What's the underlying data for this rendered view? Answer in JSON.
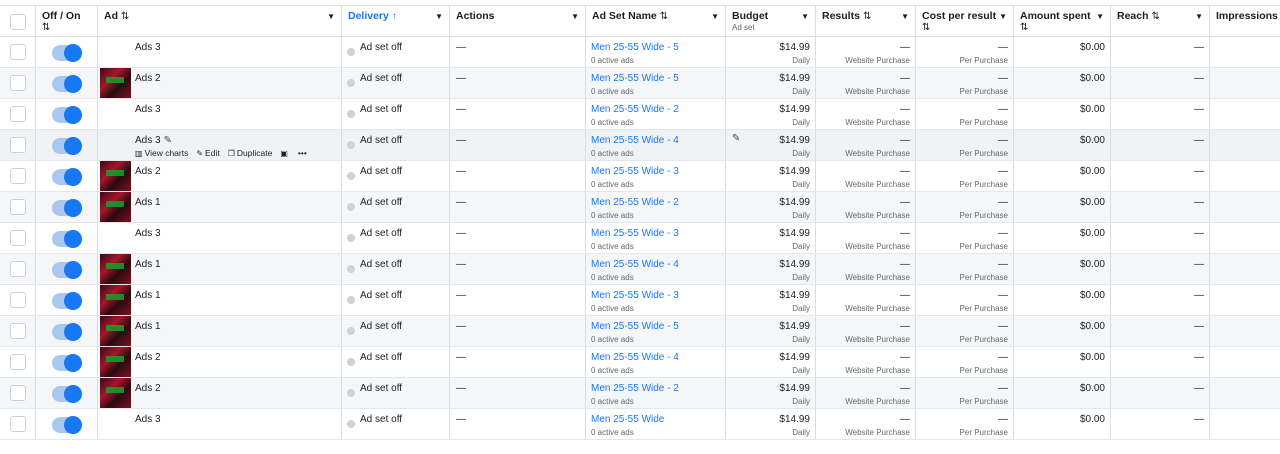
{
  "columns": {
    "toggle": "Off / On",
    "ad": "Ad",
    "delivery": "Delivery",
    "actions": "Actions",
    "adset": "Ad Set Name",
    "budget": "Budget",
    "budget_sub": "Ad set",
    "results": "Results",
    "cpr": "Cost per result",
    "amount": "Amount spent",
    "reach": "Reach",
    "impressions": "Impressions"
  },
  "icons": {
    "sort": "⇅",
    "sort_up": "↑",
    "caret": "▼",
    "pencil": "✎"
  },
  "hover_actions": {
    "view_charts": "View charts",
    "edit": "Edit",
    "duplicate": "Duplicate",
    "more": "•••"
  },
  "rows": [
    {
      "ad": "Ads 3",
      "thumb": false,
      "delivery": "Ad set off",
      "action": "—",
      "adset": "Men 25-55 Wide - 5",
      "adset_sub": "0 active ads",
      "budget": "$14.99",
      "budget_sub": "Daily",
      "results": "—",
      "results_sub": "Website Purchase",
      "cpr": "—",
      "cpr_sub": "Per Purchase",
      "amount": "$0.00",
      "reach": "—"
    },
    {
      "ad": "Ads 2",
      "thumb": true,
      "delivery": "Ad set off",
      "action": "—",
      "adset": "Men 25-55 Wide - 5",
      "adset_sub": "0 active ads",
      "budget": "$14.99",
      "budget_sub": "Daily",
      "results": "—",
      "results_sub": "Website Purchase",
      "cpr": "—",
      "cpr_sub": "Per Purchase",
      "amount": "$0.00",
      "reach": "—"
    },
    {
      "ad": "Ads 3",
      "thumb": false,
      "delivery": "Ad set off",
      "action": "—",
      "adset": "Men 25-55 Wide - 2",
      "adset_sub": "0 active ads",
      "budget": "$14.99",
      "budget_sub": "Daily",
      "results": "—",
      "results_sub": "Website Purchase",
      "cpr": "—",
      "cpr_sub": "Per Purchase",
      "amount": "$0.00",
      "reach": "—"
    },
    {
      "ad": "Ads 3",
      "thumb": false,
      "delivery": "Ad set off",
      "action": "—",
      "adset": "Men 25-55 Wide - 4",
      "adset_sub": "0 active ads",
      "budget": "$14.99",
      "budget_sub": "Daily",
      "results": "—",
      "results_sub": "Website Purchase",
      "cpr": "—",
      "cpr_sub": "Per Purchase",
      "amount": "$0.00",
      "reach": "—"
    },
    {
      "ad": "Ads 2",
      "thumb": true,
      "delivery": "Ad set off",
      "action": "—",
      "adset": "Men 25-55 Wide - 3",
      "adset_sub": "0 active ads",
      "budget": "$14.99",
      "budget_sub": "Daily",
      "results": "—",
      "results_sub": "Website Purchase",
      "cpr": "—",
      "cpr_sub": "Per Purchase",
      "amount": "$0.00",
      "reach": "—"
    },
    {
      "ad": "Ads 1",
      "thumb": true,
      "delivery": "Ad set off",
      "action": "—",
      "adset": "Men 25-55 Wide - 2",
      "adset_sub": "0 active ads",
      "budget": "$14.99",
      "budget_sub": "Daily",
      "results": "—",
      "results_sub": "Website Purchase",
      "cpr": "—",
      "cpr_sub": "Per Purchase",
      "amount": "$0.00",
      "reach": "—"
    },
    {
      "ad": "Ads 3",
      "thumb": false,
      "delivery": "Ad set off",
      "action": "—",
      "adset": "Men 25-55 Wide - 3",
      "adset_sub": "0 active ads",
      "budget": "$14.99",
      "budget_sub": "Daily",
      "results": "—",
      "results_sub": "Website Purchase",
      "cpr": "—",
      "cpr_sub": "Per Purchase",
      "amount": "$0.00",
      "reach": "—"
    },
    {
      "ad": "Ads 1",
      "thumb": true,
      "delivery": "Ad set off",
      "action": "—",
      "adset": "Men 25-55 Wide - 4",
      "adset_sub": "0 active ads",
      "budget": "$14.99",
      "budget_sub": "Daily",
      "results": "—",
      "results_sub": "Website Purchase",
      "cpr": "—",
      "cpr_sub": "Per Purchase",
      "amount": "$0.00",
      "reach": "—"
    },
    {
      "ad": "Ads 1",
      "thumb": true,
      "delivery": "Ad set off",
      "action": "—",
      "adset": "Men 25-55 Wide - 3",
      "adset_sub": "0 active ads",
      "budget": "$14.99",
      "budget_sub": "Daily",
      "results": "—",
      "results_sub": "Website Purchase",
      "cpr": "—",
      "cpr_sub": "Per Purchase",
      "amount": "$0.00",
      "reach": "—"
    },
    {
      "ad": "Ads 1",
      "thumb": true,
      "delivery": "Ad set off",
      "action": "—",
      "adset": "Men 25-55 Wide - 5",
      "adset_sub": "0 active ads",
      "budget": "$14.99",
      "budget_sub": "Daily",
      "results": "—",
      "results_sub": "Website Purchase",
      "cpr": "—",
      "cpr_sub": "Per Purchase",
      "amount": "$0.00",
      "reach": "—"
    },
    {
      "ad": "Ads 2",
      "thumb": true,
      "delivery": "Ad set off",
      "action": "—",
      "adset": "Men 25-55 Wide - 4",
      "adset_sub": "0 active ads",
      "budget": "$14.99",
      "budget_sub": "Daily",
      "results": "—",
      "results_sub": "Website Purchase",
      "cpr": "—",
      "cpr_sub": "Per Purchase",
      "amount": "$0.00",
      "reach": "—"
    },
    {
      "ad": "Ads 2",
      "thumb": true,
      "delivery": "Ad set off",
      "action": "—",
      "adset": "Men 25-55 Wide - 2",
      "adset_sub": "0 active ads",
      "budget": "$14.99",
      "budget_sub": "Daily",
      "results": "—",
      "results_sub": "Website Purchase",
      "cpr": "—",
      "cpr_sub": "Per Purchase",
      "amount": "$0.00",
      "reach": "—"
    },
    {
      "ad": "Ads 3",
      "thumb": false,
      "delivery": "Ad set off",
      "action": "—",
      "adset": "Men 25-55 Wide",
      "adset_sub": "0 active ads",
      "budget": "$14.99",
      "budget_sub": "Daily",
      "results": "—",
      "results_sub": "Website Purchase",
      "cpr": "—",
      "cpr_sub": "Per Purchase",
      "amount": "$0.00",
      "reach": "—"
    }
  ],
  "hover_row_index": 3,
  "colors": {
    "accent": "#1877f2",
    "toggle_track": "#a8c8f0",
    "link": "#1877f2"
  }
}
